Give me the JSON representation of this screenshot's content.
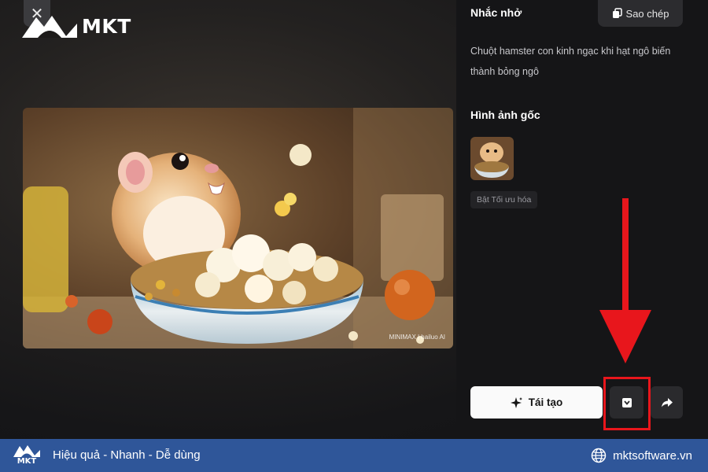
{
  "brand": {
    "name": "MKT"
  },
  "header": {
    "close_icon": "close-icon"
  },
  "preview": {
    "watermark": "MINIMAX | hailuo AI"
  },
  "prompt_section": {
    "title": "Nhắc nhở",
    "copy_label": "Sao chép",
    "text": "Chuột hamster con kinh ngạc khi hạt ngô biến thành bỏng ngô"
  },
  "original_section": {
    "title": "Hình ảnh gốc",
    "badge": "Bật Tối ưu hóa"
  },
  "actions": {
    "regenerate_label": "Tái tạo",
    "download_icon": "download-icon",
    "share_icon": "share-icon"
  },
  "annotation": {
    "color": "#e8161c"
  },
  "footer": {
    "brand": "MKT",
    "tagline": "Hiệu quả - Nhanh - Dễ dùng",
    "website": "mktsoftware.vn",
    "background": "#2f5699"
  }
}
